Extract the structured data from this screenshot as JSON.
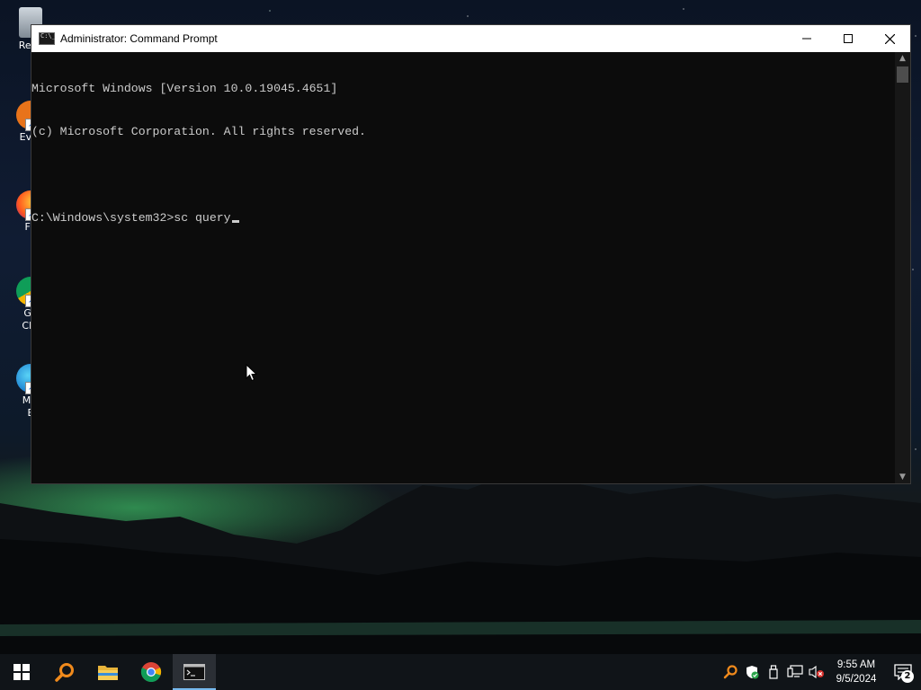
{
  "window": {
    "title": "Administrator: Command Prompt",
    "console_lines": [
      "Microsoft Windows [Version 10.0.19045.4651]",
      "(c) Microsoft Corporation. All rights reserved.",
      ""
    ],
    "prompt": "C:\\Windows\\system32>",
    "typed_command": "sc query"
  },
  "desktop": {
    "icons": [
      {
        "label": "Recy",
        "icon": "recycle-bin-icon"
      },
      {
        "label": "Ever",
        "icon": "everything-search-icon"
      },
      {
        "label": "Fir",
        "icon": "firefox-icon"
      },
      {
        "label": "Go",
        "label2": "Chr",
        "icon": "chrome-icon"
      },
      {
        "label": "Mic",
        "label2": "E",
        "icon": "edge-icon"
      }
    ]
  },
  "taskbar": {
    "items": [
      "start-icon",
      "search-icon",
      "file-explorer-icon",
      "chrome-icon",
      "command-prompt-icon"
    ],
    "active_item": "command-prompt-icon",
    "tray_icons": [
      "search-tool-icon",
      "windows-security-icon",
      "usb-icon",
      "network-icon",
      "volume-muted-icon"
    ],
    "time": "9:55 AM",
    "date": "9/5/2024",
    "notification_count": "2"
  },
  "colors": {
    "console_bg": "#0c0c0c",
    "console_text": "#cccccc",
    "titlebar_bg": "#ffffff",
    "taskbar_bg": "#101418",
    "accent": "#76b9ed"
  }
}
